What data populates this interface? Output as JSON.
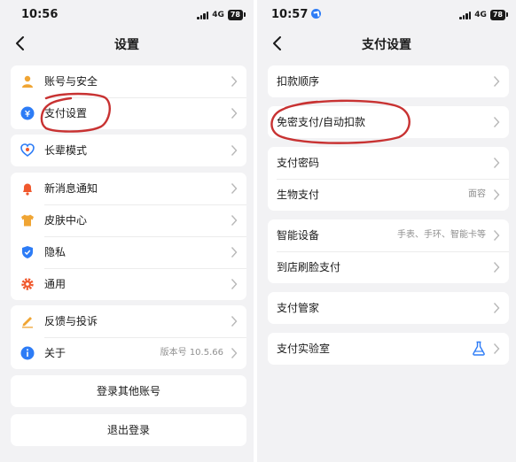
{
  "left": {
    "status": {
      "time": "10:56",
      "network": "4G",
      "battery": "78"
    },
    "title": "设置",
    "groups": [
      [
        {
          "label": "账号与安全",
          "icon": "user-icon",
          "color": "#f0a534"
        },
        {
          "label": "支付设置",
          "icon": "payment-icon",
          "color": "#2d7cf6"
        }
      ],
      [
        {
          "label": "长辈模式",
          "icon": "heart-icon",
          "color": "#2d7cf6"
        }
      ],
      [
        {
          "label": "新消息通知",
          "icon": "bell-icon",
          "color": "#f0582d"
        },
        {
          "label": "皮肤中心",
          "icon": "shirt-icon",
          "color": "#f0a534"
        },
        {
          "label": "隐私",
          "icon": "shield-icon",
          "color": "#2d7cf6"
        },
        {
          "label": "通用",
          "icon": "gear-icon",
          "color": "#f0582d"
        }
      ],
      [
        {
          "label": "反馈与投诉",
          "icon": "pencil-icon",
          "color": "#f0a534"
        },
        {
          "label": "关于",
          "icon": "info-icon",
          "color": "#2d7cf6",
          "value": "版本号 10.5.66"
        }
      ]
    ],
    "buttons": {
      "login_other": "登录其他账号",
      "logout": "退出登录"
    }
  },
  "right": {
    "status": {
      "time": "10:57",
      "network": "4G",
      "battery": "78"
    },
    "title": "支付设置",
    "groups": [
      [
        {
          "label": "扣款顺序"
        }
      ],
      [
        {
          "label": "免密支付/自动扣款"
        }
      ],
      [
        {
          "label": "支付密码"
        },
        {
          "label": "生物支付",
          "value": "面容"
        }
      ],
      [
        {
          "label": "智能设备",
          "value": "手表、手环、智能卡等"
        },
        {
          "label": "到店刷脸支付"
        }
      ],
      [
        {
          "label": "支付管家"
        }
      ],
      [
        {
          "label": "支付实验室",
          "icon": "flask-icon",
          "color": "#2d7cf6"
        }
      ]
    ]
  },
  "annotation_color": "#c83232"
}
